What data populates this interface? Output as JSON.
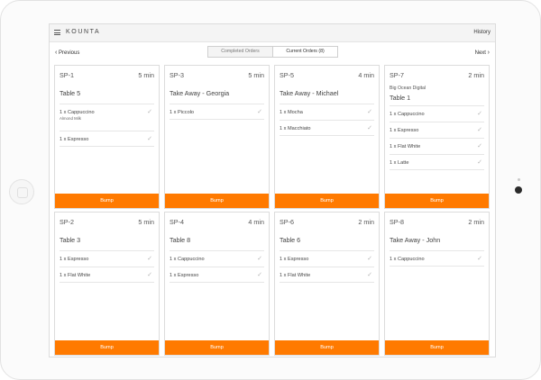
{
  "app": {
    "logo": "KOUNTA",
    "history": "History"
  },
  "nav": {
    "prev": "Previous",
    "next": "Next",
    "tabs": [
      "Completed Orders",
      "Current Orders (8)"
    ]
  },
  "orders": [
    {
      "id": "SP-1",
      "time": "5 min",
      "title": "Table 5",
      "subtitle": "",
      "items": [
        {
          "text": "1 x Cappuccino",
          "modifier": "Almond Milk"
        },
        {
          "text": "1 x Espresso",
          "modifier": ""
        }
      ],
      "bump": "Bump"
    },
    {
      "id": "SP-3",
      "time": "5 min",
      "title": "Take Away - Georgia",
      "subtitle": "",
      "items": [
        {
          "text": "1 x Piccolo",
          "modifier": ""
        }
      ],
      "bump": "Bump"
    },
    {
      "id": "SP-5",
      "time": "4 min",
      "title": "Take Away - Michael",
      "subtitle": "",
      "items": [
        {
          "text": "1 x Mocha",
          "modifier": ""
        },
        {
          "text": "1 x Macchiato",
          "modifier": ""
        }
      ],
      "bump": "Bump"
    },
    {
      "id": "SP-7",
      "time": "2 min",
      "title": "Table 1",
      "subtitle": "Big Ocean Digital",
      "items": [
        {
          "text": "1 x Cappuccino",
          "modifier": ""
        },
        {
          "text": "1 x Espresso",
          "modifier": ""
        },
        {
          "text": "1 x Flat White",
          "modifier": ""
        },
        {
          "text": "1 x Latte",
          "modifier": ""
        }
      ],
      "bump": "Bump"
    },
    {
      "id": "SP-2",
      "time": "5 min",
      "title": "Table 3",
      "subtitle": "",
      "items": [
        {
          "text": "1 x Espresso",
          "modifier": ""
        },
        {
          "text": "1 x Flat White",
          "modifier": ""
        }
      ],
      "bump": "Bump"
    },
    {
      "id": "SP-4",
      "time": "4 min",
      "title": "Table 8",
      "subtitle": "",
      "items": [
        {
          "text": "1 x Cappuccino",
          "modifier": ""
        },
        {
          "text": "1 x Espresso",
          "modifier": ""
        }
      ],
      "bump": "Bump"
    },
    {
      "id": "SP-6",
      "time": "2 min",
      "title": "Table 6",
      "subtitle": "",
      "items": [
        {
          "text": "1 x Espresso",
          "modifier": ""
        },
        {
          "text": "1 x Flat White",
          "modifier": ""
        }
      ],
      "bump": "Bump"
    },
    {
      "id": "SP-8",
      "time": "2 min",
      "title": "Take Away - John",
      "subtitle": "",
      "items": [
        {
          "text": "1 x Cappuccino",
          "modifier": ""
        }
      ],
      "bump": "Bump"
    }
  ],
  "colors": {
    "accent": "#ff7a00",
    "check": "#b5b5b5"
  },
  "icons": {
    "menu": "hamburger-icon",
    "prev": "chevron-left-icon",
    "next": "chevron-right-icon",
    "check": "check-icon"
  }
}
